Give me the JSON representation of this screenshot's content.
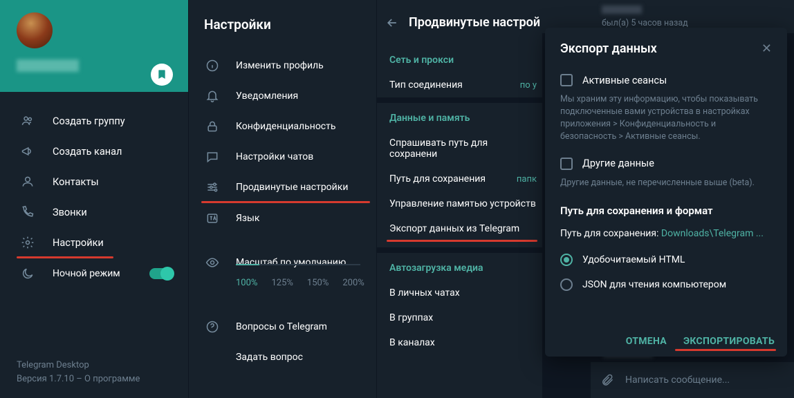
{
  "sidebar": {
    "items": [
      {
        "label": "Создать группу"
      },
      {
        "label": "Создать канал"
      },
      {
        "label": "Контакты"
      },
      {
        "label": "Звонки"
      },
      {
        "label": "Настройки"
      },
      {
        "label": "Ночной режим"
      }
    ],
    "footer_app": "Telegram Desktop",
    "footer_version": "Версия 1.7.10 – О программе"
  },
  "settings": {
    "title": "Настройки",
    "items": [
      "Изменить профиль",
      "Уведомления",
      "Конфиденциальность",
      "Настройки чатов",
      "Продвинутые настройки",
      "Язык"
    ],
    "zoom_label": "Масштаб по умолчанию",
    "zoom_levels": [
      "100%",
      "125%",
      "150%",
      "200%"
    ],
    "faq": "Вопросы о Telegram",
    "ask": "Задать вопрос"
  },
  "advanced": {
    "title": "Продвинутые настрой",
    "net_section": "Сеть и прокси",
    "conn_type": "Тип соединения",
    "conn_value": "по у",
    "data_section": "Данные и память",
    "ask_path": "Спрашивать путь для сохранени",
    "save_path": "Путь для сохранения",
    "save_value": "папк",
    "mem": "Управление памятью устройств",
    "export": "Экспорт данных из Telegram",
    "media_section": "Автозагрузка медиа",
    "in_private": "В личных чатах",
    "in_groups": "В группах",
    "in_channels": "В каналах"
  },
  "chat": {
    "status": "был(а) 5 часов назад",
    "compose_placeholder": "Написать сообщение...",
    "time_dots": "..."
  },
  "export": {
    "title": "Экспорт данных",
    "sessions": "Активные сеансы",
    "sessions_desc": "Мы храним эту информацию, чтобы показывать подключенные вами устройства в настройках приложения > Конфиденциальность и безопасность > Активные сеансы.",
    "other": "Другие данные",
    "other_desc": "Другие данные, не перечисленные выше (beta).",
    "path_section": "Путь для сохранения и формат",
    "path_label": "Путь для сохранения: ",
    "path_value": "Downloads\\Telegram ...",
    "fmt_html": "Удобочитаемый HTML",
    "fmt_json": "JSON для чтения компьютером",
    "cancel": "ОТМЕНА",
    "export_btn": "ЭКСПОРТИРОВАТЬ"
  }
}
